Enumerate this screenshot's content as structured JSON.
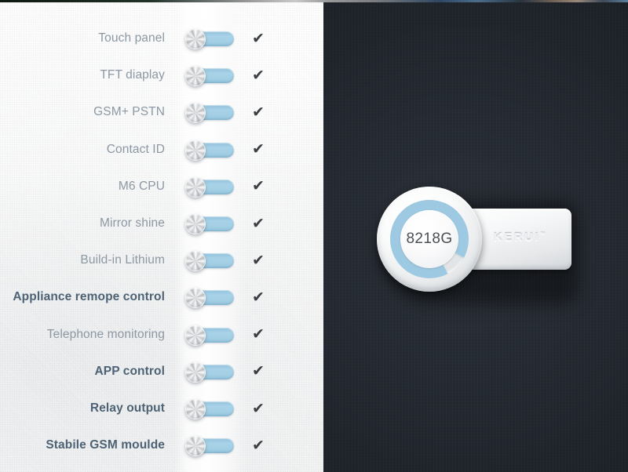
{
  "panels": {
    "features": {
      "name": "Feature list panel",
      "accent_blue": "#a3cfe4",
      "label_color": "#8c98a4",
      "label_emphasis_color": "#4d6274",
      "check_glyph": "✔",
      "rows": [
        {
          "label": "Touch panel",
          "enabled": true,
          "checked": true,
          "emphasis": false
        },
        {
          "label": "TFT diaplay",
          "enabled": true,
          "checked": true,
          "emphasis": false
        },
        {
          "label": "GSM+ PSTN",
          "enabled": true,
          "checked": true,
          "emphasis": false
        },
        {
          "label": "Contact ID",
          "enabled": true,
          "checked": true,
          "emphasis": false
        },
        {
          "label": "M6 CPU",
          "enabled": true,
          "checked": true,
          "emphasis": false
        },
        {
          "label": "Mirror shine",
          "enabled": true,
          "checked": true,
          "emphasis": false
        },
        {
          "label": "Build-in Lithium",
          "enabled": true,
          "checked": true,
          "emphasis": false
        },
        {
          "label": "Appliance remope control",
          "enabled": true,
          "checked": true,
          "emphasis": true
        },
        {
          "label": "Telephone monitoring",
          "enabled": true,
          "checked": true,
          "emphasis": false
        },
        {
          "label": "APP control",
          "enabled": true,
          "checked": true,
          "emphasis": true
        },
        {
          "label": "Relay output",
          "enabled": true,
          "checked": true,
          "emphasis": true
        },
        {
          "label": "Stabile GSM moulde",
          "enabled": true,
          "checked": true,
          "emphasis": true
        }
      ]
    },
    "product": {
      "name": "Product photo panel",
      "background_color": "#22272e",
      "device": {
        "model": "8218G",
        "brand": "KERUI",
        "brand_mark": "™",
        "ring_color": "#9dc9e2",
        "body_color": "#f4f6f7"
      }
    }
  }
}
